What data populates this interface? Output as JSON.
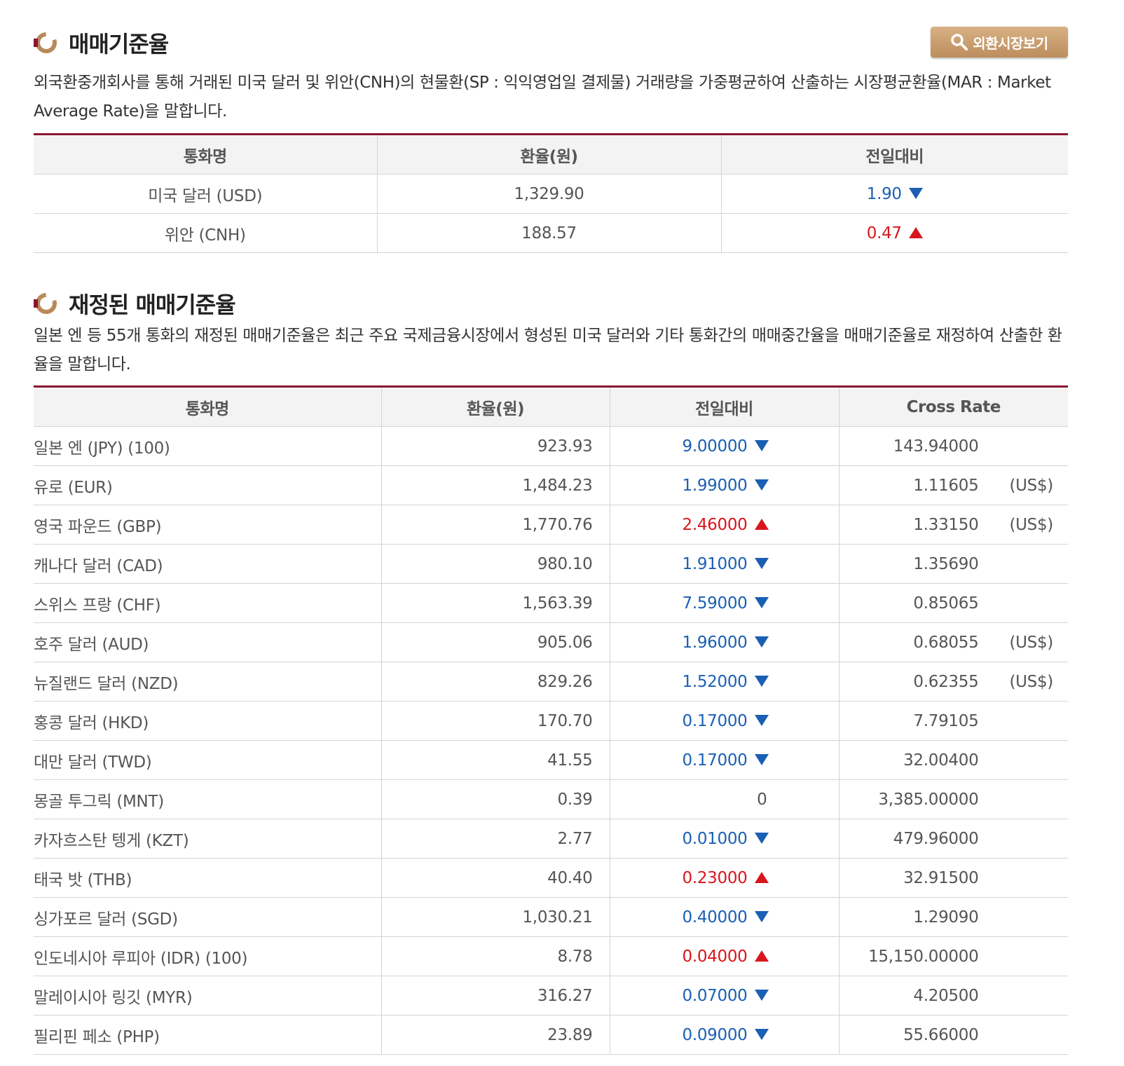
{
  "section1": {
    "title": "매매기준율",
    "button_label": "외환시장보기",
    "description": "외국환중개회사를 통해 거래된 미국 달러 및 위안(CNH)의 현물환(SP : 익익영업일 결제물) 거래량을 가중평균하여 산출하는 시장평균환율(MAR : Market Average Rate)을 말합니다.",
    "headers": [
      "통화명",
      "환율(원)",
      "전일대비"
    ],
    "rows": [
      {
        "name": "미국 달러 (USD)",
        "rate": "1,329.90",
        "change": "1.90",
        "direction": "down"
      },
      {
        "name": "위안 (CNH)",
        "rate": "188.57",
        "change": "0.47",
        "direction": "up"
      }
    ]
  },
  "section2": {
    "title": "재정된 매매기준율",
    "description": "일본 엔 등 55개 통화의 재정된 매매기준율은 최근 주요 국제금융시장에서 형성된 미국 달러와 기타 통화간의 매매중간율을 매매기준율로 재정하여 산출한 환율을 말합니다.",
    "headers": [
      "통화명",
      "환율(원)",
      "전일대비",
      "Cross Rate"
    ],
    "rows": [
      {
        "name": "일본 엔 (JPY) (100)",
        "rate": "923.93",
        "change": "9.00000",
        "direction": "down",
        "cross": "143.94000",
        "unit": ""
      },
      {
        "name": "유로 (EUR)",
        "rate": "1,484.23",
        "change": "1.99000",
        "direction": "down",
        "cross": "1.11605",
        "unit": "(US$)"
      },
      {
        "name": "영국 파운드 (GBP)",
        "rate": "1,770.76",
        "change": "2.46000",
        "direction": "up",
        "cross": "1.33150",
        "unit": "(US$)"
      },
      {
        "name": "캐나다 달러 (CAD)",
        "rate": "980.10",
        "change": "1.91000",
        "direction": "down",
        "cross": "1.35690",
        "unit": ""
      },
      {
        "name": "스위스 프랑 (CHF)",
        "rate": "1,563.39",
        "change": "7.59000",
        "direction": "down",
        "cross": "0.85065",
        "unit": ""
      },
      {
        "name": "호주 달러 (AUD)",
        "rate": "905.06",
        "change": "1.96000",
        "direction": "down",
        "cross": "0.68055",
        "unit": "(US$)"
      },
      {
        "name": "뉴질랜드 달러 (NZD)",
        "rate": "829.26",
        "change": "1.52000",
        "direction": "down",
        "cross": "0.62355",
        "unit": "(US$)"
      },
      {
        "name": "홍콩 달러 (HKD)",
        "rate": "170.70",
        "change": "0.17000",
        "direction": "down",
        "cross": "7.79105",
        "unit": ""
      },
      {
        "name": "대만 달러 (TWD)",
        "rate": "41.55",
        "change": "0.17000",
        "direction": "down",
        "cross": "32.00400",
        "unit": ""
      },
      {
        "name": "몽골 투그릭 (MNT)",
        "rate": "0.39",
        "change": "0",
        "direction": "none",
        "cross": "3,385.00000",
        "unit": ""
      },
      {
        "name": "카자흐스탄 텡게 (KZT)",
        "rate": "2.77",
        "change": "0.01000",
        "direction": "down",
        "cross": "479.96000",
        "unit": ""
      },
      {
        "name": "태국 밧 (THB)",
        "rate": "40.40",
        "change": "0.23000",
        "direction": "up",
        "cross": "32.91500",
        "unit": ""
      },
      {
        "name": "싱가포르 달러 (SGD)",
        "rate": "1,030.21",
        "change": "0.40000",
        "direction": "down",
        "cross": "1.29090",
        "unit": ""
      },
      {
        "name": "인도네시아 루피아 (IDR) (100)",
        "rate": "8.78",
        "change": "0.04000",
        "direction": "up",
        "cross": "15,150.00000",
        "unit": ""
      },
      {
        "name": "말레이시아 링깃 (MYR)",
        "rate": "316.27",
        "change": "0.07000",
        "direction": "down",
        "cross": "4.20500",
        "unit": ""
      },
      {
        "name": "필리핀 페소 (PHP)",
        "rate": "23.89",
        "change": "0.09000",
        "direction": "down",
        "cross": "55.66000",
        "unit": ""
      }
    ]
  },
  "colors": {
    "accent": "#8a1633",
    "button": "#c89a6a",
    "down": "#1a5fb4",
    "up": "#d9151c"
  },
  "icons": {
    "title": "ring-icon",
    "button": "search-icon",
    "down": "triangle-down-icon",
    "up": "triangle-up-icon"
  }
}
